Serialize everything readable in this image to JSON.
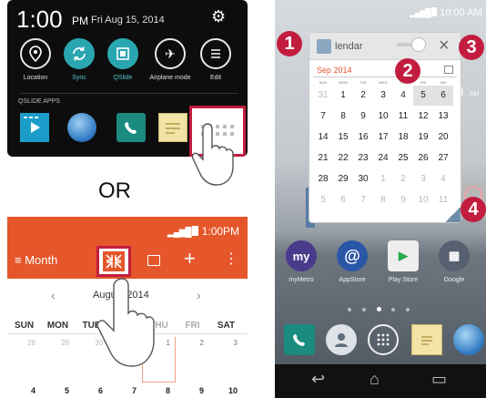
{
  "notification_panel": {
    "time": "1:00",
    "ampm": "PM",
    "date": "Fri Aug 15, 2014",
    "settings_icon": "gear-icon",
    "quick_settings": [
      {
        "label": "Location",
        "icon": "location-icon",
        "active": false
      },
      {
        "label": "Sync",
        "icon": "sync-icon",
        "active": true
      },
      {
        "label": "QSlide",
        "icon": "qslide-icon",
        "active": true
      },
      {
        "label": "Airplane mode",
        "icon": "airplane-icon",
        "active": false
      },
      {
        "label": "Edit",
        "icon": "edit-icon",
        "active": false
      }
    ],
    "section_label": "QSLIDE APPS",
    "apps": [
      {
        "label": "Video",
        "icon": "video-icon"
      },
      {
        "label": "Internet",
        "icon": "globe-icon"
      },
      {
        "label": "Phone",
        "icon": "phone-icon"
      },
      {
        "label": "Memo",
        "icon": "memo-icon"
      },
      {
        "label": "Calendar",
        "icon": "calendar-icon"
      }
    ]
  },
  "or_label": "OR",
  "calendar_app": {
    "status_time": "1:00PM",
    "view_label": "Month",
    "month_label": "August 2014",
    "weekdays": [
      "SUN",
      "MON",
      "TUE",
      "WED",
      "THU",
      "FRI",
      "SAT"
    ],
    "row1": [
      "28",
      "29",
      "30",
      "31",
      "1",
      "2",
      "3"
    ],
    "row2": [
      "4",
      "5",
      "6",
      "7",
      "8",
      "9",
      "10"
    ]
  },
  "phone": {
    "status_time": "10:00 AM",
    "clock": "0",
    "clock_am": "AM",
    "widget": {
      "app_name": "lendar",
      "month": "Sep 2014",
      "weekdays": [
        "SUN",
        "MON",
        "TUE",
        "WED",
        "THU",
        "FRI",
        "SAT"
      ],
      "weeks": [
        [
          "31",
          "1",
          "2",
          "3",
          "4",
          "5",
          "6"
        ],
        [
          "7",
          "8",
          "9",
          "10",
          "11",
          "12",
          "13"
        ],
        [
          "14",
          "15",
          "16",
          "17",
          "18",
          "19",
          "20"
        ],
        [
          "21",
          "22",
          "23",
          "24",
          "25",
          "26",
          "27"
        ],
        [
          "28",
          "29",
          "30",
          "1",
          "2",
          "3",
          "4"
        ],
        [
          "5",
          "6",
          "7",
          "8",
          "9",
          "10",
          "11"
        ]
      ]
    },
    "home_apps": [
      {
        "label": "myMetro",
        "glyph": "my",
        "color": "#4a3a8c"
      },
      {
        "label": "AppStore",
        "glyph": "@",
        "color": "#2a56a8"
      },
      {
        "label": "Play Store",
        "glyph": "▶",
        "color": "#e0e0e0"
      },
      {
        "label": "Google",
        "glyph": "▦",
        "color": "#566070"
      }
    ]
  },
  "callouts": [
    "1",
    "2",
    "3",
    "4"
  ]
}
